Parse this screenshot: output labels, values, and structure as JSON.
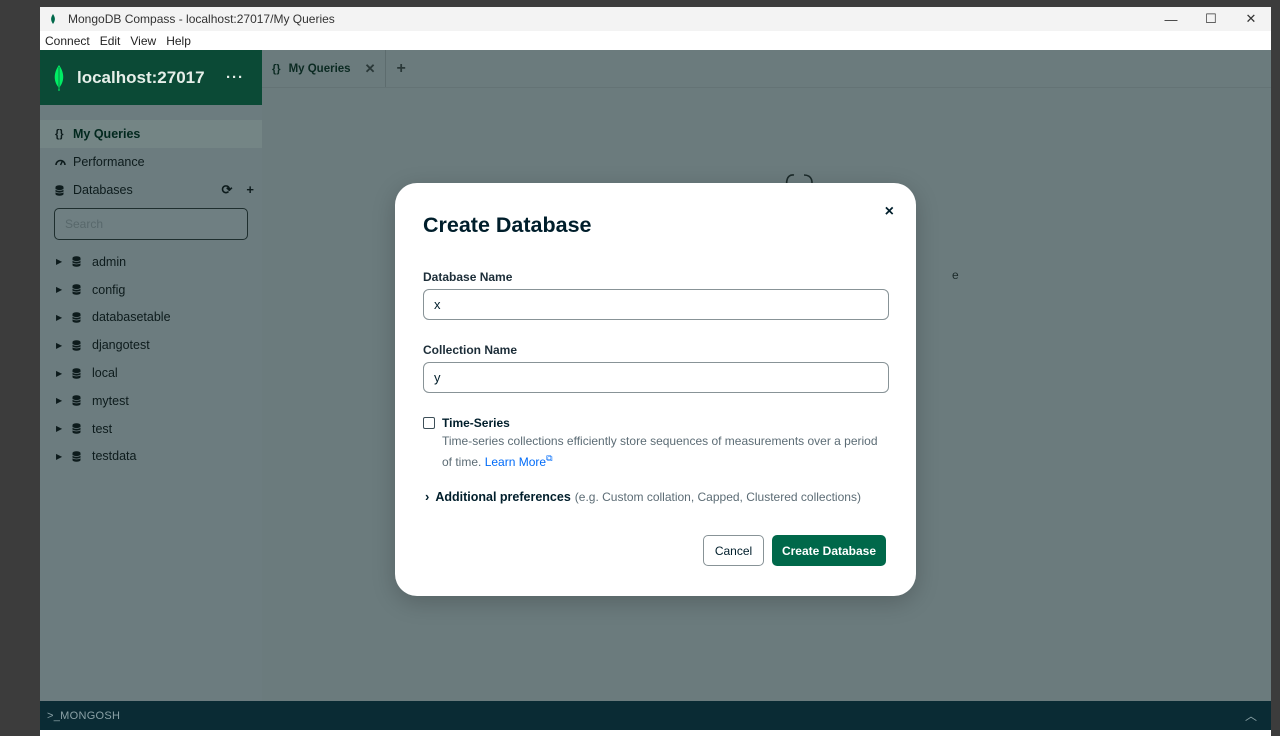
{
  "window": {
    "title": "MongoDB Compass - localhost:27017/My Queries",
    "controls": [
      "minimize",
      "maximize",
      "close"
    ]
  },
  "menu": {
    "items": [
      "Connect",
      "Edit",
      "View",
      "Help"
    ]
  },
  "sidebar": {
    "host": "localhost:27017",
    "more_label": "···",
    "nav": [
      {
        "label": "My Queries",
        "icon": "braces-icon",
        "active": true
      },
      {
        "label": "Performance",
        "icon": "gauge-icon",
        "active": false
      },
      {
        "label": "Databases",
        "icon": "database-icon",
        "active": false
      }
    ],
    "search_placeholder": "Search",
    "databases": [
      "admin",
      "config",
      "databasetable",
      "djangotest",
      "local",
      "mytest",
      "test",
      "testdata"
    ]
  },
  "tabs": {
    "active": {
      "braces": "{}",
      "label": "My Queries",
      "close": "✕"
    },
    "add": "+"
  },
  "background_fragment": "e",
  "bottombar": {
    "label": ">_MONGOSH"
  },
  "modal": {
    "title": "Create Database",
    "close": "×",
    "db_name_label": "Database Name",
    "db_name_value": "x",
    "coll_name_label": "Collection Name",
    "coll_name_value": "y",
    "timeseries_label": "Time-Series",
    "timeseries_desc": "Time-series collections efficiently store sequences of measurements over a period of time.",
    "learn_more": "Learn More",
    "adv_title": "Additional preferences",
    "adv_hint": "(e.g. Custom collation, Capped, Clustered collections)",
    "cancel": "Cancel",
    "create": "Create Database"
  },
  "colors": {
    "primary_green": "#00684a",
    "sidebar_header": "#0b4a36",
    "link_blue": "#016bf8"
  }
}
